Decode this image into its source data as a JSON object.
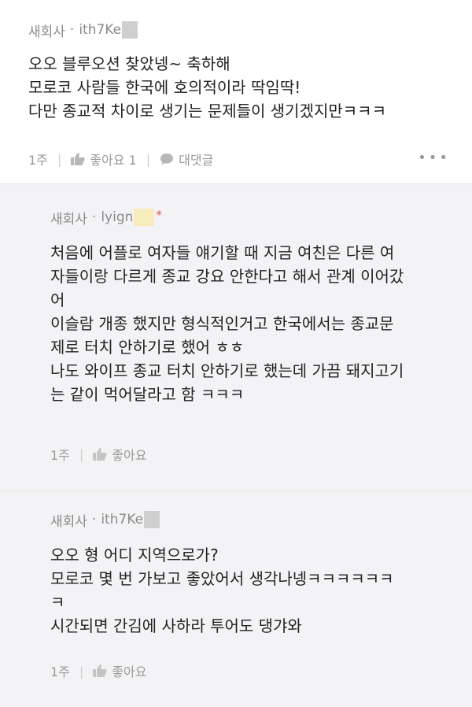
{
  "comments": [
    {
      "author_prefix": "새회사",
      "author_id": "ith7Ke",
      "lines": [
        "오오 블루오션 찾았넹~ 축하해",
        "모로코 사람들 한국에 호의적이라 딱임딱!",
        "다만 종교적 차이로 생기는 문제들이 생기겠지만ㅋㅋㅋ"
      ],
      "time": "1주",
      "like_label": "좋아요 1",
      "reply_label": "대댓글",
      "more_icon": "more-dots-icon"
    },
    {
      "author_prefix": "새회사",
      "author_id": "lyign",
      "star": "*",
      "lines": [
        "처음에 어플로 여자들 얘기할 때 지금 여친은 다른 여",
        "자들이랑 다르게 종교 강요 안한다고 해서 관계 이어갔",
        "어",
        "이슬람 개종 했지만 형식적인거고 한국에서는 종교문",
        "제로 터치 안하기로 했어 ㅎㅎ",
        "나도 와이프 종교 터치 안하기로 했는데 가끔 돼지고기",
        "는 같이 먹어달라고 함 ㅋㅋㅋ"
      ],
      "time": "1주",
      "like_label": "좋아요"
    },
    {
      "author_prefix": "새회사",
      "author_id": "ith7Ke",
      "lines": [
        "오오 형 어디 지역으로가?",
        "모로코 몇 번 가보고 좋았어서 생각나넹ㅋㅋㅋㅋㅋㅋ",
        "ㅋ",
        "시간되면 간김에 사하라 투어도 댕갸와"
      ],
      "time": "1주",
      "like_label": "좋아요"
    }
  ],
  "colors": {
    "meta": "#8a8a8a",
    "reply_bg": "#f3f3f5",
    "star": "#e0544b"
  }
}
